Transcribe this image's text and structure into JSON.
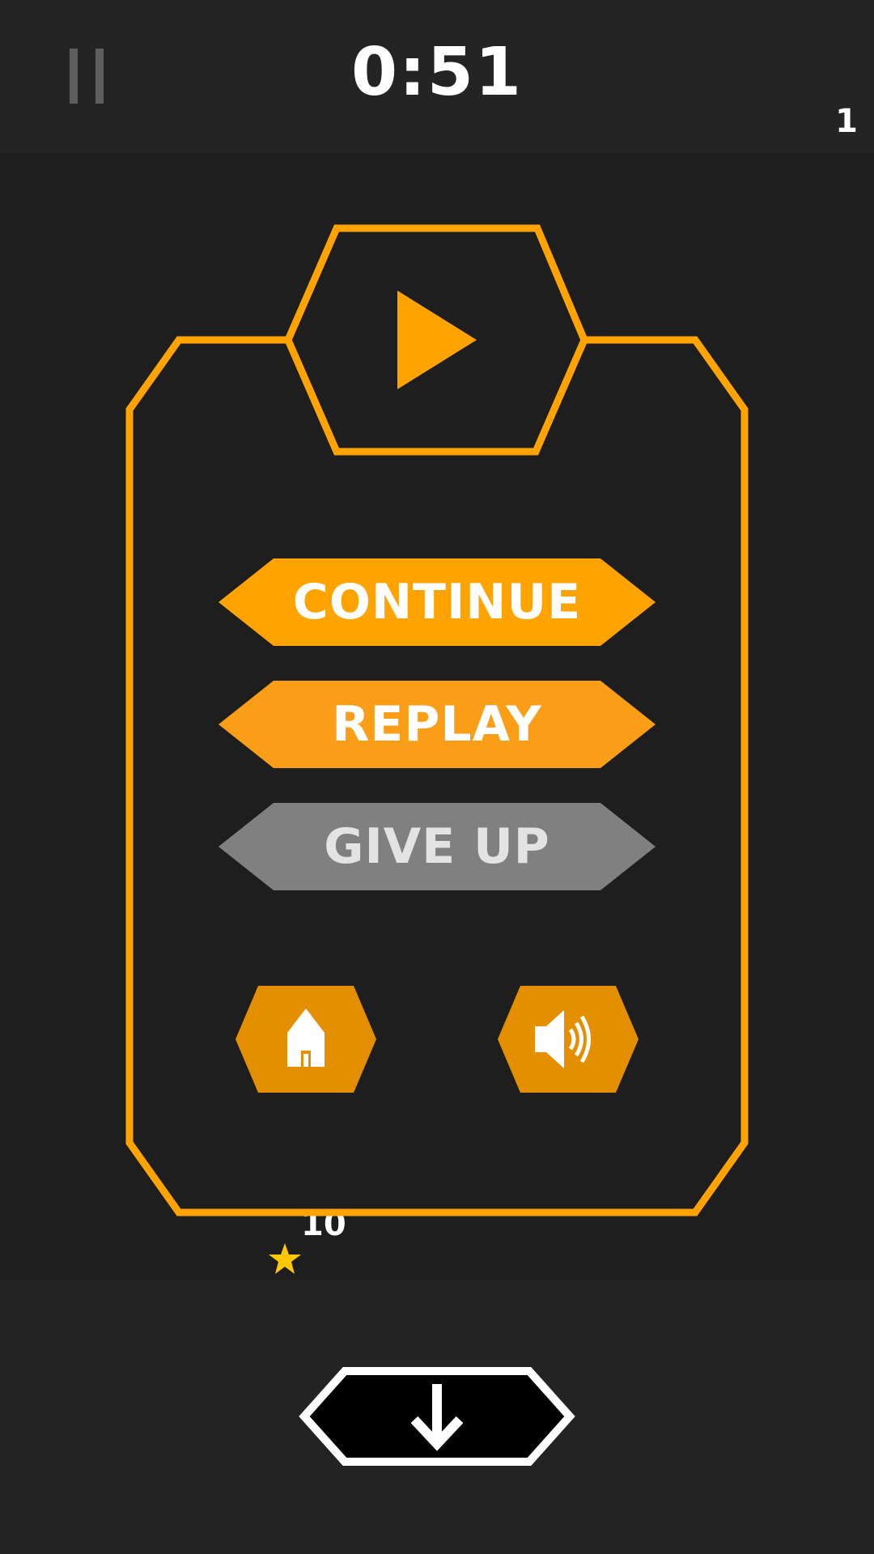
{
  "hud": {
    "timer": "0:51",
    "level_count": "1"
  },
  "pause_menu": {
    "continue_label": "CONTINUE",
    "replay_label": "REPLAY",
    "give_up_label": "GIVE UP"
  },
  "score": {
    "star_value": "10"
  },
  "icons": {
    "pause": "pause-icon",
    "play": "play-icon",
    "home": "home-icon",
    "sound": "speaker-icon",
    "drop": "arrow-down-icon",
    "star": "star-icon"
  },
  "colors": {
    "accent_orange": "#ffa300",
    "replay_orange": "#f99e16",
    "icon_button_orange": "#e38f00",
    "give_up_gray": "#808080",
    "give_up_text": "#e3e3e3",
    "background": "#1e1e1e",
    "star_yellow": "#ffc800"
  }
}
